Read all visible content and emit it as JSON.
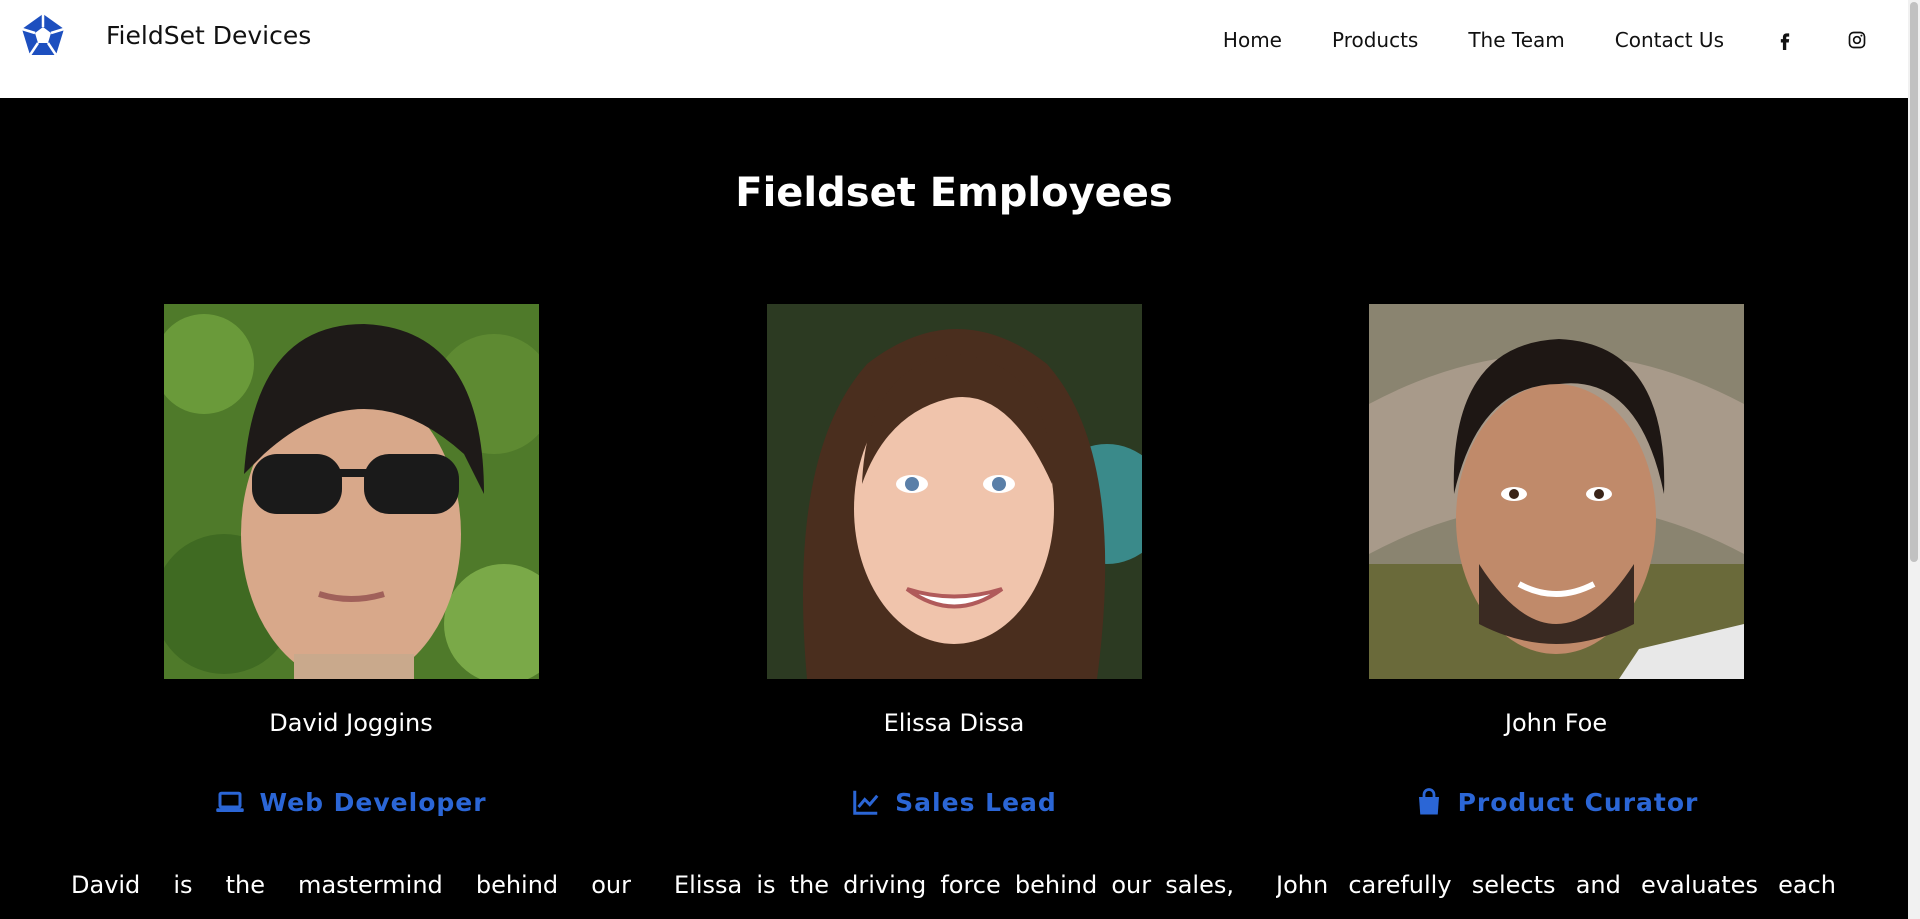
{
  "brand": {
    "name": "FieldSet Devices",
    "logo_icon": "pentagon-logo-icon",
    "accent": "#1d4fbf"
  },
  "nav": {
    "items": [
      "Home",
      "Products",
      "The Team",
      "Contact Us"
    ],
    "social": [
      "facebook-icon",
      "instagram-icon"
    ]
  },
  "section": {
    "title": "Fieldset Employees"
  },
  "employees": [
    {
      "name": "David Joggins",
      "role": "Web Developer",
      "role_icon": "laptop-icon",
      "bio": "David is the mastermind behind our"
    },
    {
      "name": "Elissa Dissa",
      "role": "Sales Lead",
      "role_icon": "chart-line-icon",
      "bio": "Elissa is the driving force behind our sales,"
    },
    {
      "name": "John Foe",
      "role": "Product Curator",
      "role_icon": "shopping-bag-icon",
      "bio": "John carefully selects and evaluates each"
    }
  ],
  "colors": {
    "role_text": "#2b66d6",
    "background": "#000000",
    "header": "#ffffff"
  }
}
